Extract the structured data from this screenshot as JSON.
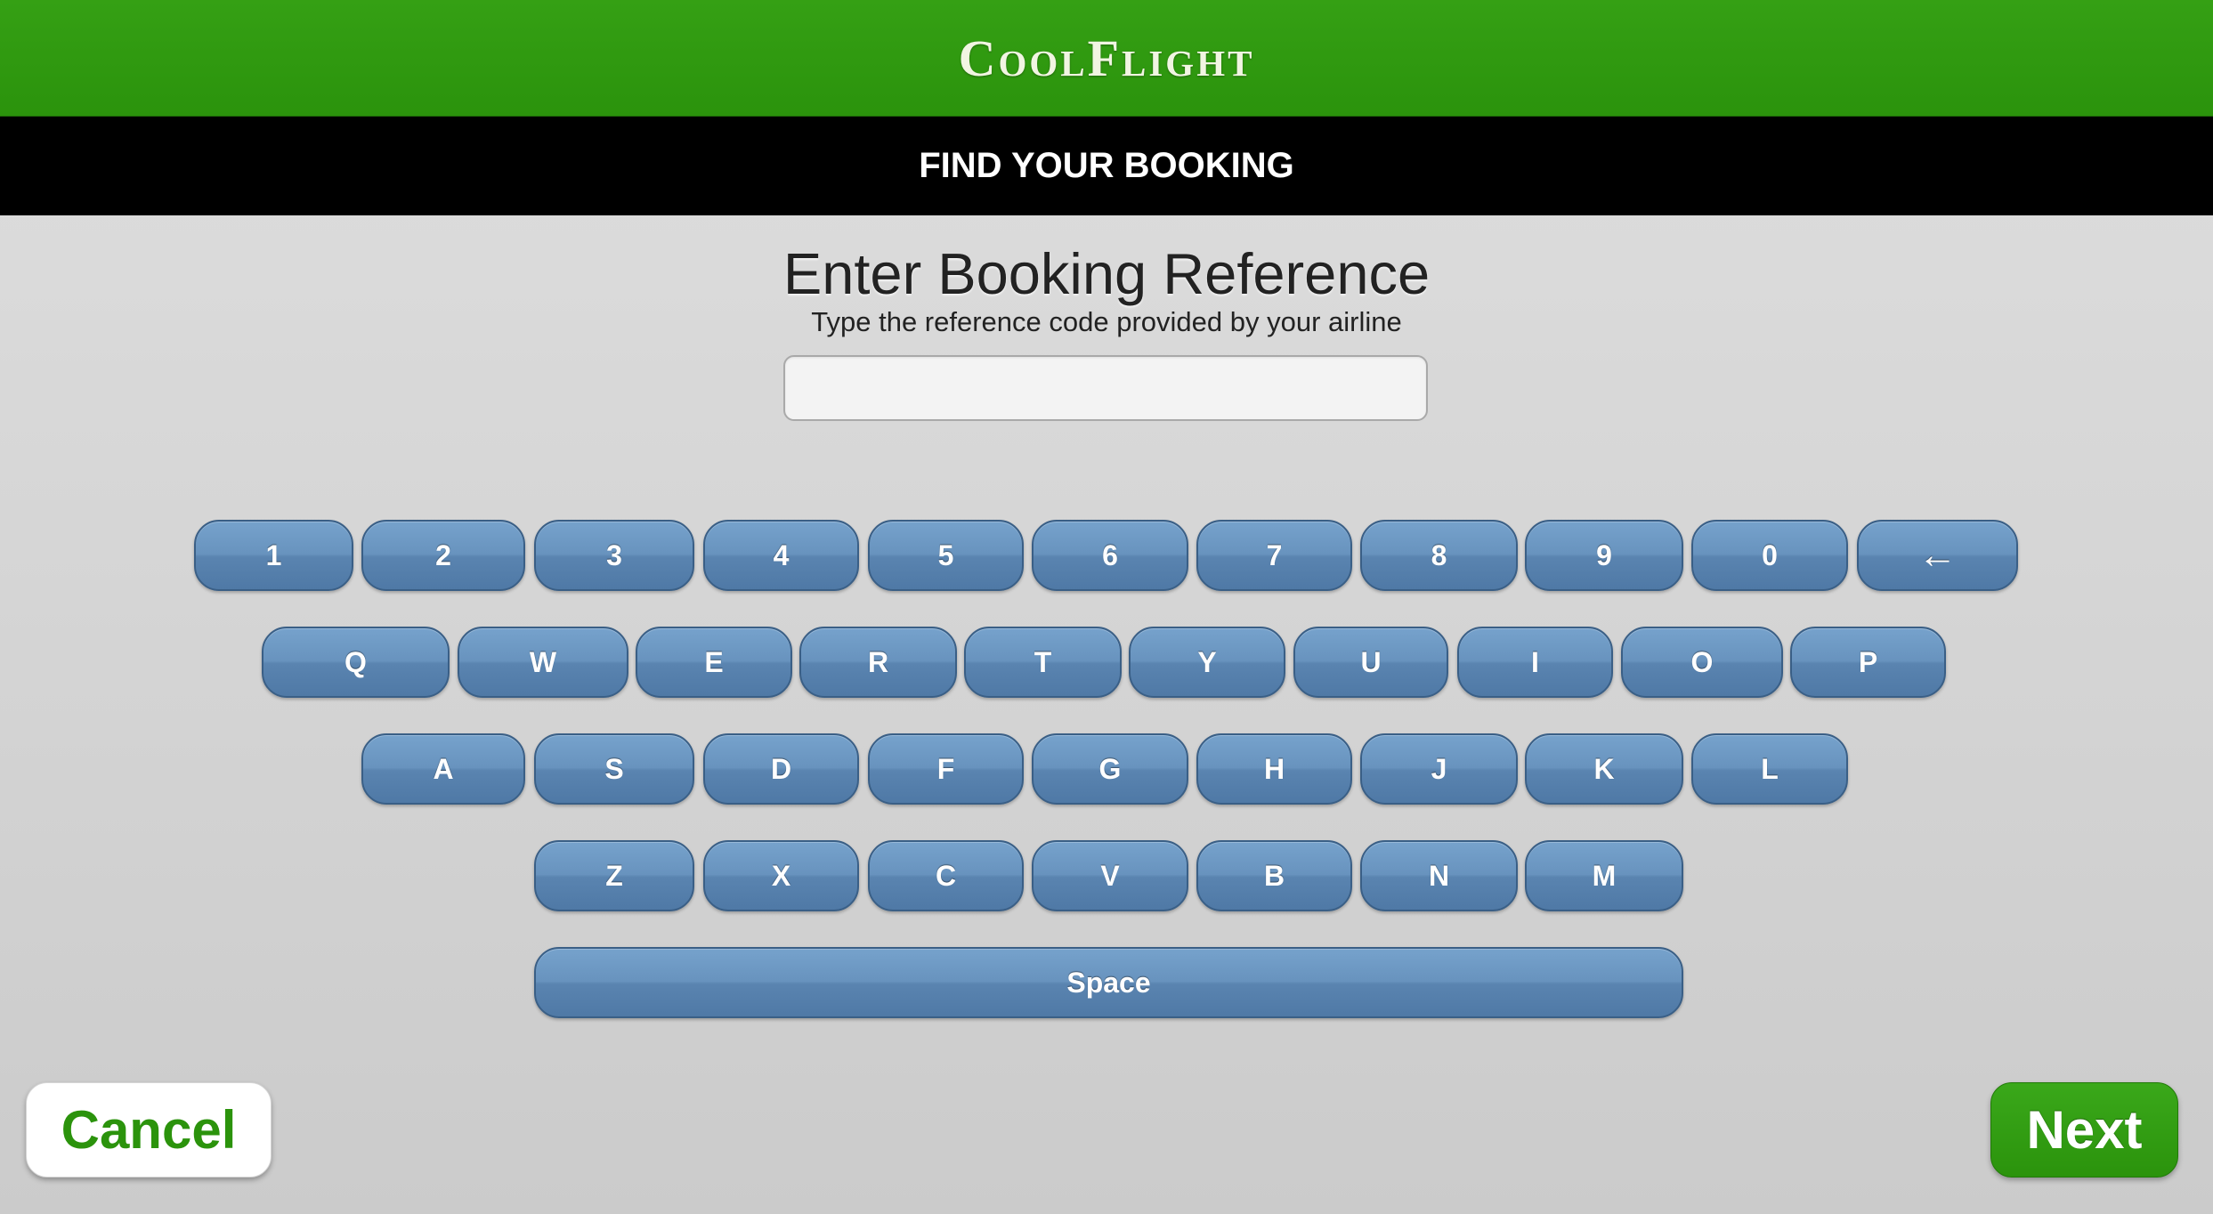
{
  "header": {
    "brand": "CoolFlight",
    "page_title": "FIND YOUR BOOKING"
  },
  "form": {
    "heading": "Enter Booking Reference",
    "subheading": "Type the reference code provided by your airline",
    "input_value": "",
    "input_placeholder": ""
  },
  "keyboard": {
    "row1": [
      "1",
      "2",
      "3",
      "4",
      "5",
      "6",
      "7",
      "8",
      "9",
      "0",
      "←"
    ],
    "row2": [
      "Q",
      "W",
      "E",
      "R",
      "T",
      "Y",
      "U",
      "I",
      "O",
      "P"
    ],
    "row3": [
      "A",
      "S",
      "D",
      "F",
      "G",
      "H",
      "J",
      "K",
      "L"
    ],
    "row4": [
      "Z",
      "X",
      "C",
      "V",
      "B",
      "N",
      "M"
    ],
    "space_label": "Space"
  },
  "actions": {
    "cancel_label": "Cancel",
    "next_label": "Next"
  },
  "colors": {
    "brand_green": "#2b930c",
    "key_blue": "#5f89b4",
    "title_bar": "#000000"
  }
}
